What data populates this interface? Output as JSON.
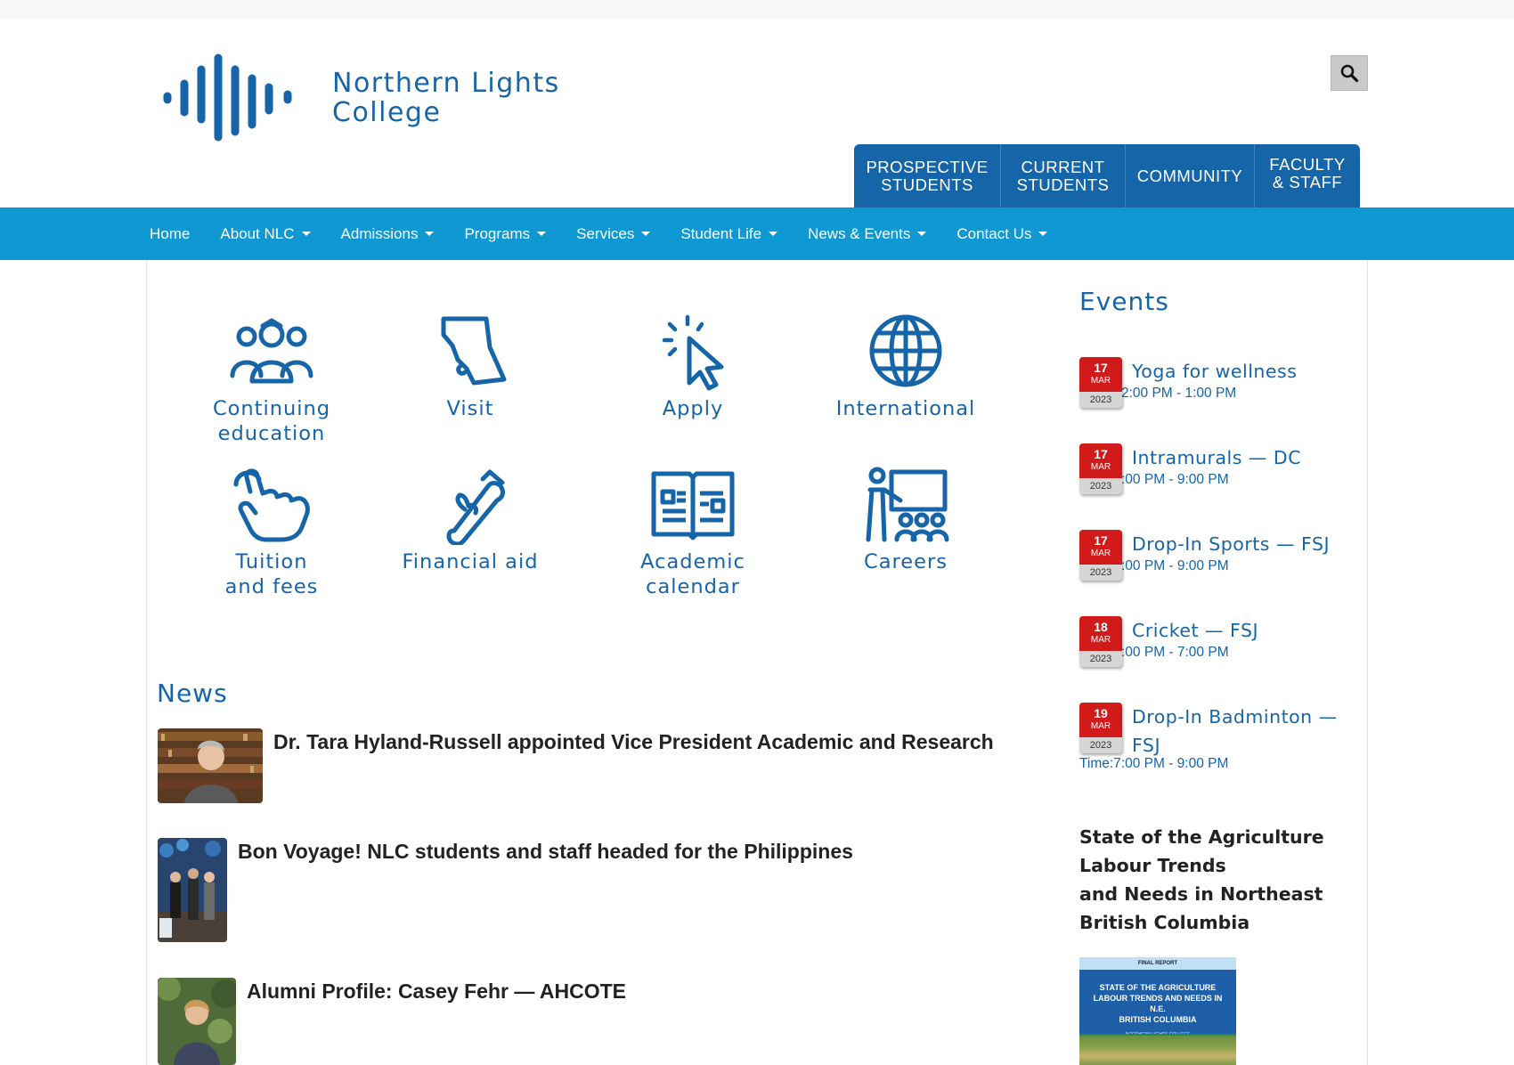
{
  "header": {
    "logo_line1": "Northern Lights",
    "logo_line2": "College",
    "search_icon": "search-icon",
    "audience_tabs": [
      {
        "line1": "PROSPECTIVE",
        "line2": "STUDENTS"
      },
      {
        "line1": "CURRENT",
        "line2": "STUDENTS"
      },
      {
        "line1": "COMMUNITY",
        "line2": ""
      },
      {
        "line1": "FACULTY",
        "line2": "& STAFF"
      }
    ]
  },
  "nav": {
    "items": [
      {
        "label": "Home",
        "dropdown": false
      },
      {
        "label": "About NLC",
        "dropdown": true
      },
      {
        "label": "Admissions",
        "dropdown": true
      },
      {
        "label": "Programs",
        "dropdown": true
      },
      {
        "label": "Services",
        "dropdown": true
      },
      {
        "label": "Student Life",
        "dropdown": true
      },
      {
        "label": "News & Events",
        "dropdown": true
      },
      {
        "label": "Contact Us",
        "dropdown": true
      }
    ]
  },
  "quick_links": [
    {
      "line1": "Continuing",
      "line2": "education",
      "icon": "people-group-icon"
    },
    {
      "line1": "Visit",
      "line2": "",
      "icon": "bc-map-icon"
    },
    {
      "line1": "Apply",
      "line2": "",
      "icon": "cursor-click-icon"
    },
    {
      "line1": "International",
      "line2": "",
      "icon": "globe-icon"
    },
    {
      "line1": "Tuition",
      "line2": "and fees",
      "icon": "hand-pointer-icon"
    },
    {
      "line1": "Financial aid",
      "line2": "",
      "icon": "diploma-scroll-icon"
    },
    {
      "line1": "Academic",
      "line2": "calendar",
      "icon": "open-book-icon"
    },
    {
      "line1": "Careers",
      "line2": "",
      "icon": "teacher-board-icon"
    }
  ],
  "news": {
    "title": "News",
    "items": [
      {
        "headline": "Dr. Tara Hyland-Russell appointed Vice President Academic and Research"
      },
      {
        "headline": "Bon Voyage! NLC students and staff headed for the Philippines"
      },
      {
        "headline": "Alumni Profile: Casey Fehr — AHCOTE"
      }
    ]
  },
  "events": {
    "title": "Events",
    "items": [
      {
        "day": "17",
        "month": "MAR",
        "year": "2023",
        "name": "Yoga for wellness",
        "name2": "",
        "time": "2:00 PM - 1:00 PM"
      },
      {
        "day": "17",
        "month": "MAR",
        "year": "2023",
        "name": "Intramurals — DC",
        "name2": "",
        "time": ":00 PM - 9:00 PM"
      },
      {
        "day": "17",
        "month": "MAR",
        "year": "2023",
        "name": "Drop-In Sports — FSJ",
        "name2": "",
        "time": ":00 PM - 9:00 PM"
      },
      {
        "day": "18",
        "month": "MAR",
        "year": "2023",
        "name": "Cricket — FSJ",
        "name2": "",
        "time": ":00 PM - 7:00 PM"
      },
      {
        "day": "19",
        "month": "MAR",
        "year": "2023",
        "name": "Drop-In Badminton —",
        "name2": "FSJ",
        "time": "Time:7:00 PM - 9:00 PM"
      }
    ]
  },
  "report": {
    "title_lines": [
      "State of the Agriculture",
      "Labour Trends",
      "and Needs in Northeast",
      "British Columbia"
    ],
    "cover_band": "FINAL REPORT",
    "cover_title_lines": [
      "STATE OF THE AGRICULTURE",
      "LABOUR TRENDS AND NEEDS IN N.E.",
      "BRITISH COLUMBIA"
    ],
    "cover_sub": "NORTHERN LIGHTS COLLEGE"
  }
}
